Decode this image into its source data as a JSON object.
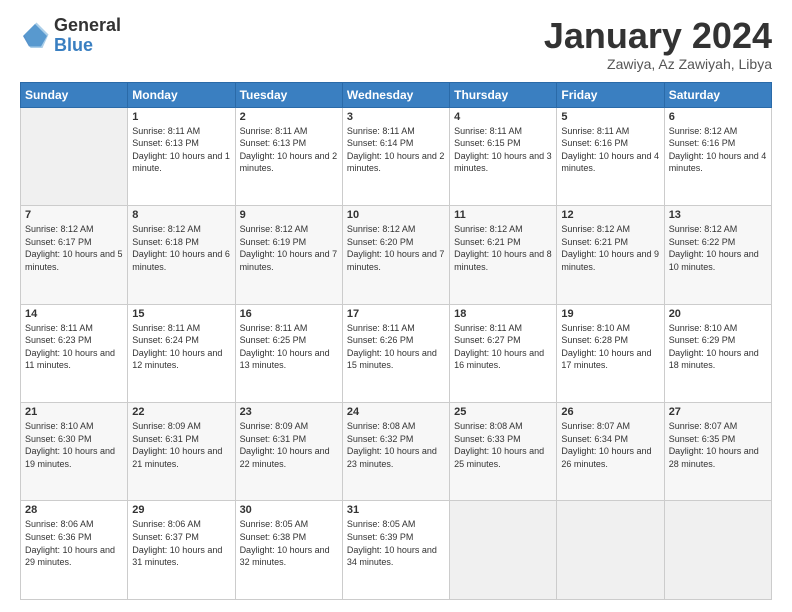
{
  "logo": {
    "general": "General",
    "blue": "Blue"
  },
  "title": "January 2024",
  "subtitle": "Zawiya, Az Zawiyah, Libya",
  "days": [
    "Sunday",
    "Monday",
    "Tuesday",
    "Wednesday",
    "Thursday",
    "Friday",
    "Saturday"
  ],
  "weeks": [
    [
      {
        "num": "",
        "sunrise": "",
        "sunset": "",
        "daylight": ""
      },
      {
        "num": "1",
        "sunrise": "Sunrise: 8:11 AM",
        "sunset": "Sunset: 6:13 PM",
        "daylight": "Daylight: 10 hours and 1 minute."
      },
      {
        "num": "2",
        "sunrise": "Sunrise: 8:11 AM",
        "sunset": "Sunset: 6:13 PM",
        "daylight": "Daylight: 10 hours and 2 minutes."
      },
      {
        "num": "3",
        "sunrise": "Sunrise: 8:11 AM",
        "sunset": "Sunset: 6:14 PM",
        "daylight": "Daylight: 10 hours and 2 minutes."
      },
      {
        "num": "4",
        "sunrise": "Sunrise: 8:11 AM",
        "sunset": "Sunset: 6:15 PM",
        "daylight": "Daylight: 10 hours and 3 minutes."
      },
      {
        "num": "5",
        "sunrise": "Sunrise: 8:11 AM",
        "sunset": "Sunset: 6:16 PM",
        "daylight": "Daylight: 10 hours and 4 minutes."
      },
      {
        "num": "6",
        "sunrise": "Sunrise: 8:12 AM",
        "sunset": "Sunset: 6:16 PM",
        "daylight": "Daylight: 10 hours and 4 minutes."
      }
    ],
    [
      {
        "num": "7",
        "sunrise": "Sunrise: 8:12 AM",
        "sunset": "Sunset: 6:17 PM",
        "daylight": "Daylight: 10 hours and 5 minutes."
      },
      {
        "num": "8",
        "sunrise": "Sunrise: 8:12 AM",
        "sunset": "Sunset: 6:18 PM",
        "daylight": "Daylight: 10 hours and 6 minutes."
      },
      {
        "num": "9",
        "sunrise": "Sunrise: 8:12 AM",
        "sunset": "Sunset: 6:19 PM",
        "daylight": "Daylight: 10 hours and 7 minutes."
      },
      {
        "num": "10",
        "sunrise": "Sunrise: 8:12 AM",
        "sunset": "Sunset: 6:20 PM",
        "daylight": "Daylight: 10 hours and 7 minutes."
      },
      {
        "num": "11",
        "sunrise": "Sunrise: 8:12 AM",
        "sunset": "Sunset: 6:21 PM",
        "daylight": "Daylight: 10 hours and 8 minutes."
      },
      {
        "num": "12",
        "sunrise": "Sunrise: 8:12 AM",
        "sunset": "Sunset: 6:21 PM",
        "daylight": "Daylight: 10 hours and 9 minutes."
      },
      {
        "num": "13",
        "sunrise": "Sunrise: 8:12 AM",
        "sunset": "Sunset: 6:22 PM",
        "daylight": "Daylight: 10 hours and 10 minutes."
      }
    ],
    [
      {
        "num": "14",
        "sunrise": "Sunrise: 8:11 AM",
        "sunset": "Sunset: 6:23 PM",
        "daylight": "Daylight: 10 hours and 11 minutes."
      },
      {
        "num": "15",
        "sunrise": "Sunrise: 8:11 AM",
        "sunset": "Sunset: 6:24 PM",
        "daylight": "Daylight: 10 hours and 12 minutes."
      },
      {
        "num": "16",
        "sunrise": "Sunrise: 8:11 AM",
        "sunset": "Sunset: 6:25 PM",
        "daylight": "Daylight: 10 hours and 13 minutes."
      },
      {
        "num": "17",
        "sunrise": "Sunrise: 8:11 AM",
        "sunset": "Sunset: 6:26 PM",
        "daylight": "Daylight: 10 hours and 15 minutes."
      },
      {
        "num": "18",
        "sunrise": "Sunrise: 8:11 AM",
        "sunset": "Sunset: 6:27 PM",
        "daylight": "Daylight: 10 hours and 16 minutes."
      },
      {
        "num": "19",
        "sunrise": "Sunrise: 8:10 AM",
        "sunset": "Sunset: 6:28 PM",
        "daylight": "Daylight: 10 hours and 17 minutes."
      },
      {
        "num": "20",
        "sunrise": "Sunrise: 8:10 AM",
        "sunset": "Sunset: 6:29 PM",
        "daylight": "Daylight: 10 hours and 18 minutes."
      }
    ],
    [
      {
        "num": "21",
        "sunrise": "Sunrise: 8:10 AM",
        "sunset": "Sunset: 6:30 PM",
        "daylight": "Daylight: 10 hours and 19 minutes."
      },
      {
        "num": "22",
        "sunrise": "Sunrise: 8:09 AM",
        "sunset": "Sunset: 6:31 PM",
        "daylight": "Daylight: 10 hours and 21 minutes."
      },
      {
        "num": "23",
        "sunrise": "Sunrise: 8:09 AM",
        "sunset": "Sunset: 6:31 PM",
        "daylight": "Daylight: 10 hours and 22 minutes."
      },
      {
        "num": "24",
        "sunrise": "Sunrise: 8:08 AM",
        "sunset": "Sunset: 6:32 PM",
        "daylight": "Daylight: 10 hours and 23 minutes."
      },
      {
        "num": "25",
        "sunrise": "Sunrise: 8:08 AM",
        "sunset": "Sunset: 6:33 PM",
        "daylight": "Daylight: 10 hours and 25 minutes."
      },
      {
        "num": "26",
        "sunrise": "Sunrise: 8:07 AM",
        "sunset": "Sunset: 6:34 PM",
        "daylight": "Daylight: 10 hours and 26 minutes."
      },
      {
        "num": "27",
        "sunrise": "Sunrise: 8:07 AM",
        "sunset": "Sunset: 6:35 PM",
        "daylight": "Daylight: 10 hours and 28 minutes."
      }
    ],
    [
      {
        "num": "28",
        "sunrise": "Sunrise: 8:06 AM",
        "sunset": "Sunset: 6:36 PM",
        "daylight": "Daylight: 10 hours and 29 minutes."
      },
      {
        "num": "29",
        "sunrise": "Sunrise: 8:06 AM",
        "sunset": "Sunset: 6:37 PM",
        "daylight": "Daylight: 10 hours and 31 minutes."
      },
      {
        "num": "30",
        "sunrise": "Sunrise: 8:05 AM",
        "sunset": "Sunset: 6:38 PM",
        "daylight": "Daylight: 10 hours and 32 minutes."
      },
      {
        "num": "31",
        "sunrise": "Sunrise: 8:05 AM",
        "sunset": "Sunset: 6:39 PM",
        "daylight": "Daylight: 10 hours and 34 minutes."
      },
      {
        "num": "",
        "sunrise": "",
        "sunset": "",
        "daylight": ""
      },
      {
        "num": "",
        "sunrise": "",
        "sunset": "",
        "daylight": ""
      },
      {
        "num": "",
        "sunrise": "",
        "sunset": "",
        "daylight": ""
      }
    ]
  ]
}
